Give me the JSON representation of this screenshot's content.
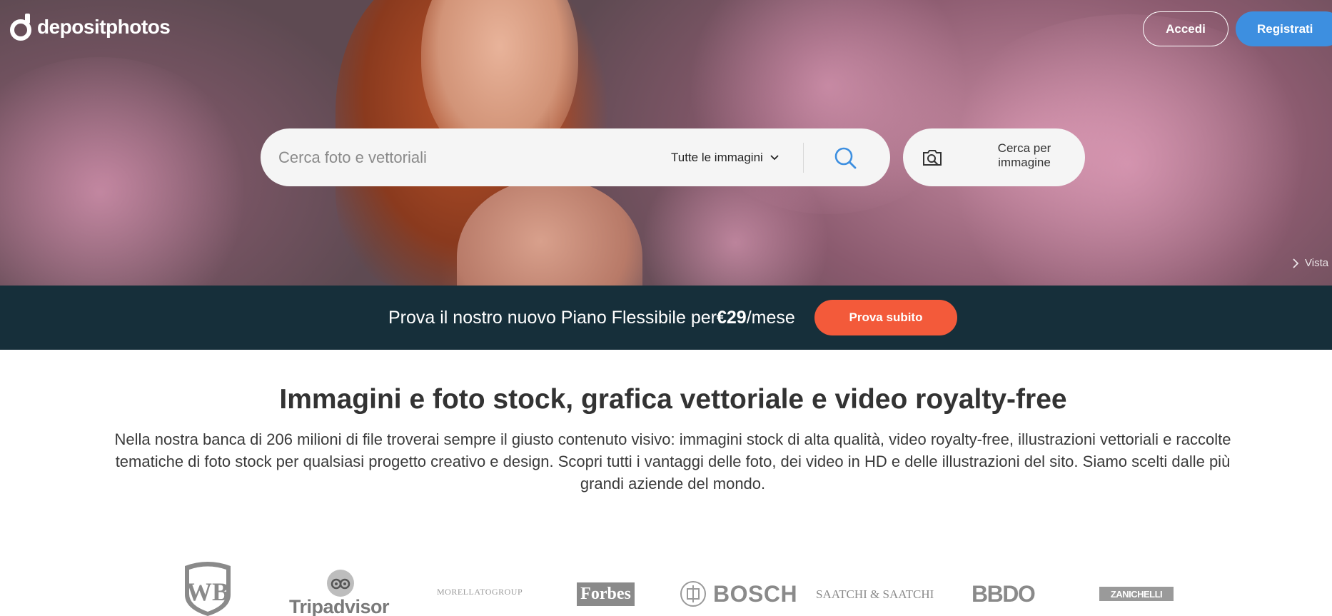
{
  "app": {
    "brand": "depositphotos"
  },
  "header": {
    "login_label": "Accedi",
    "register_label": "Registrati"
  },
  "search": {
    "placeholder": "Cerca foto e vettoriali",
    "type_selected": "Tutte le immagini",
    "image_search_label": "Cerca per immagine"
  },
  "hero": {
    "view_link": "Vista"
  },
  "promo": {
    "text_before": "Prova il nostro nuovo Piano Flessibile per ",
    "price": "€29",
    "text_after": "/mese",
    "button_label": "Prova subito"
  },
  "main": {
    "title": "Immagini e foto stock, grafica vettoriale e video royalty-free",
    "description": "Nella nostra banca di 206 milioni di file troverai sempre il giusto contenuto visivo: immagini stock di alta qualità, video royalty-free, illustrazioni vettoriali e raccolte tematiche di foto stock per qualsiasi progetto creativo e design. Scopri tutti i vantaggi delle foto, dei video in HD e delle illustrazioni del sito. Siamo scelti dalle più grandi aziende del mondo."
  },
  "brands": {
    "wb": "WB",
    "tripadvisor": "Tripadvisor",
    "morellato": "MORELLATOGROUP",
    "forbes": "Forbes",
    "bosch": "BOSCH",
    "saatchi": "SAATCHI & SAATCHI",
    "bbdo": "BBDO",
    "zanichelli": "ZANICHELLI"
  },
  "colors": {
    "register_button": "#3d8fe0",
    "promo_bar": "#162f3a",
    "promo_button": "#f35a3a",
    "search_icon": "#3d8fe0"
  },
  "icons": {
    "search": "search-icon",
    "camera": "camera-search-icon",
    "chevron": "chevron-down-icon",
    "arrow": "chevron-right-icon"
  }
}
